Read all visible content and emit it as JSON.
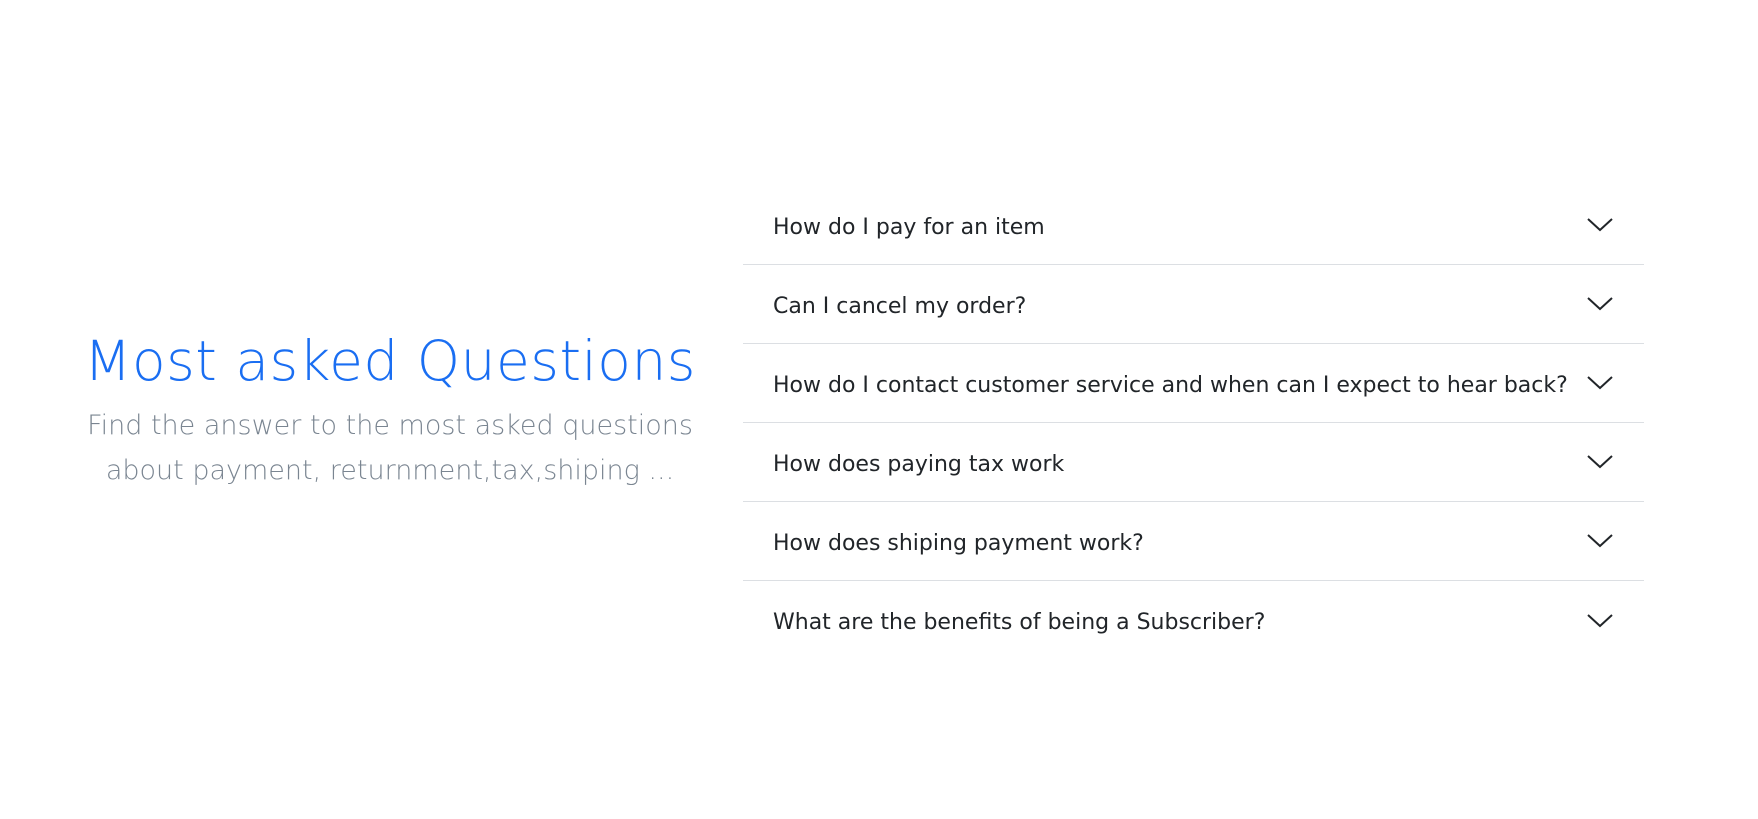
{
  "intro": {
    "title": "Most asked Questions",
    "subtitle_line1": "Find the answer to the most asked questions",
    "subtitle_line2": "about payment, returnment,tax,shiping ..."
  },
  "colors": {
    "accent": "#1a6ef2",
    "subtitle": "#7a8591",
    "question_text": "#212529",
    "divider": "#dcdfe3"
  },
  "faq": {
    "items": [
      {
        "question": "How do I pay for an item",
        "icon": "chevron-down-icon"
      },
      {
        "question": "Can I cancel my order?",
        "icon": "chevron-down-icon"
      },
      {
        "question": "How do I contact customer service and when can I expect to hear back?",
        "icon": "chevron-down-icon"
      },
      {
        "question": "How does paying tax work",
        "icon": "chevron-down-icon"
      },
      {
        "question": "How does shiping payment work?",
        "icon": "chevron-down-icon"
      },
      {
        "question": "What are the benefits of being a Subscriber?",
        "icon": "chevron-down-icon"
      }
    ]
  }
}
